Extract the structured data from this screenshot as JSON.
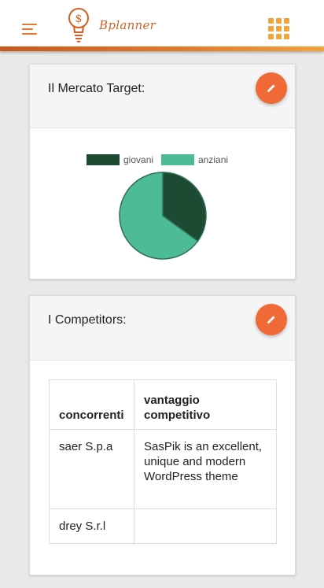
{
  "header": {
    "app_name": "Bplanner",
    "menu_icon": "hamburger-menu-icon",
    "apps_icon": "apps-grid-icon",
    "logo_icon": "lightbulb-dollar-icon",
    "accent_color": "#ef6a36"
  },
  "market_card": {
    "title": "Il Mercato Target:",
    "edit_icon": "pencil-icon",
    "chart_data": {
      "type": "pie",
      "title": "",
      "labels": [
        "giovani",
        "anziani"
      ],
      "values": [
        35,
        65
      ],
      "colors": [
        "#1c4a33",
        "#4dbb95"
      ],
      "legend": "top"
    }
  },
  "competitors_card": {
    "title": "I Competitors:",
    "edit_icon": "pencil-icon",
    "table": {
      "headers": [
        "concorrenti",
        "vantaggio competitivo"
      ],
      "rows": [
        [
          "saer S.p.a",
          "SasPik is an excellent, unique and modern WordPress theme"
        ],
        [
          "drey S.r.l",
          ""
        ]
      ]
    }
  }
}
